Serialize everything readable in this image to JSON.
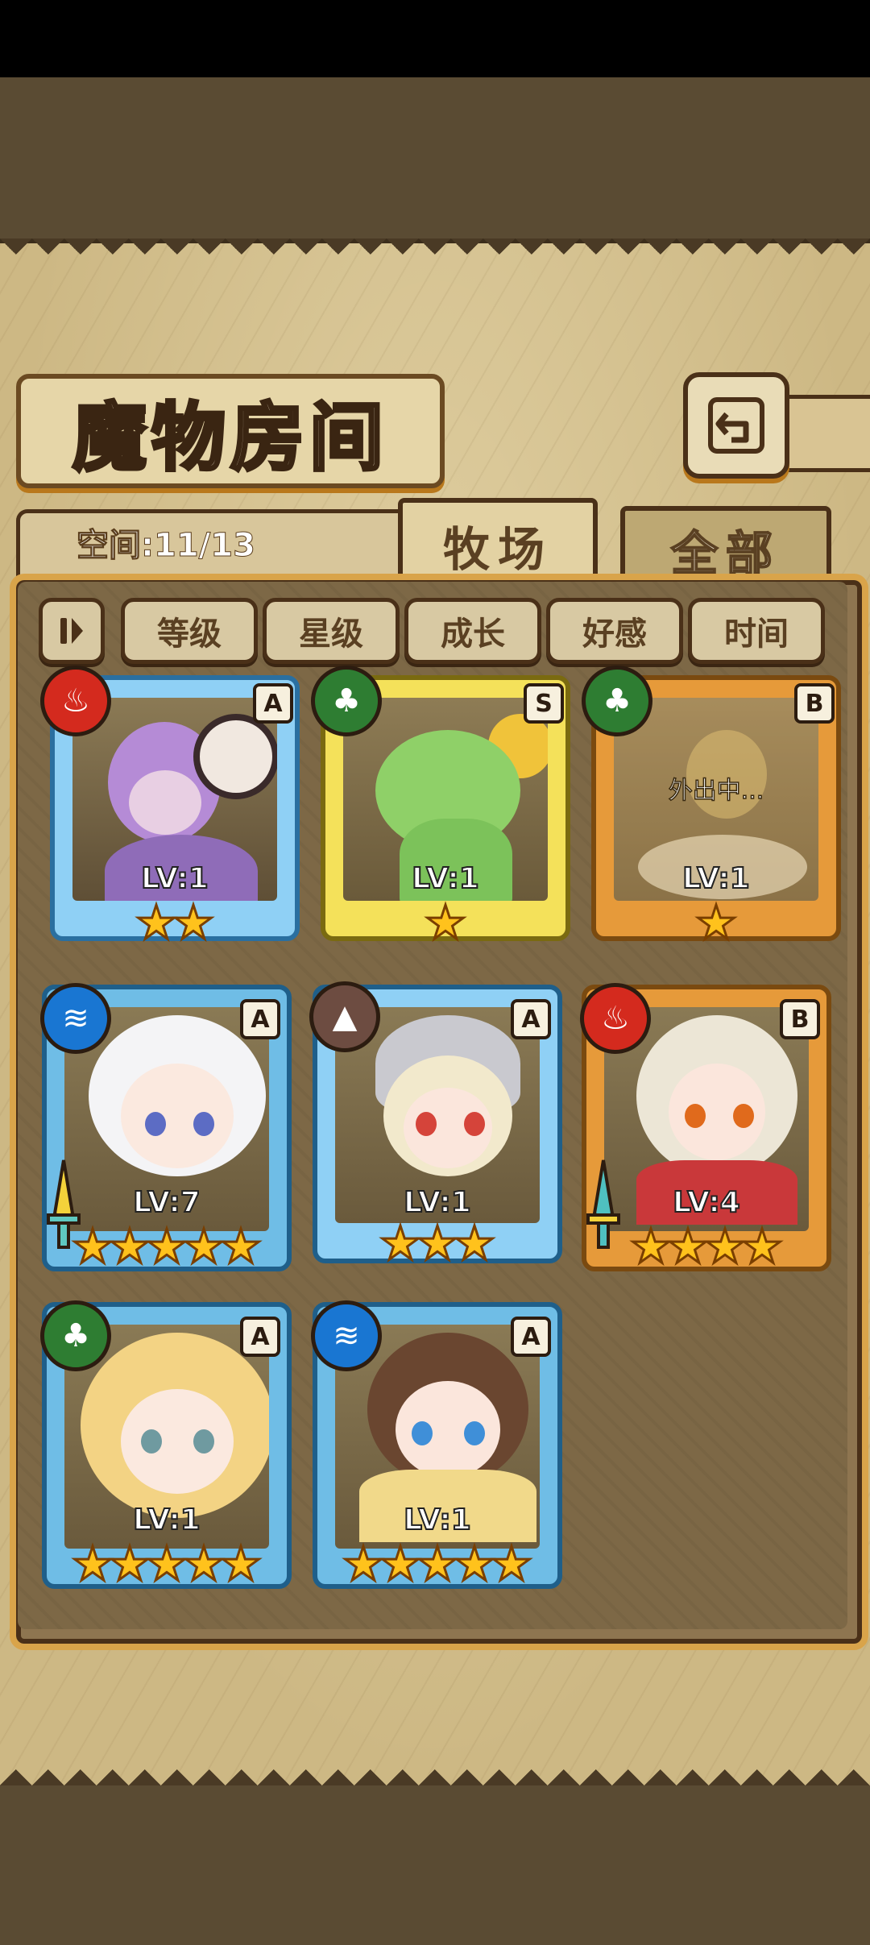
{
  "screen": {
    "title": "魔物房间",
    "back_icon": "return-arrow-icon"
  },
  "capacity": {
    "label": "空间:11/13"
  },
  "tabs": [
    {
      "label": "牧场",
      "active": true
    },
    {
      "label": "全部",
      "active": false
    }
  ],
  "sort": {
    "toggle_icon": "sort-order-icon",
    "buttons": [
      "等级",
      "星级",
      "成长",
      "好感",
      "时间"
    ]
  },
  "colors": {
    "fire": "#d42a1e",
    "grass": "#2e7d32",
    "water": "#1976d2",
    "earth": "#6d4c41",
    "frame_blue": "#5fb3e8",
    "frame_gold": "#f2d24a",
    "frame_orange": "#e69a3a"
  },
  "monsters": [
    {
      "element": "fire",
      "element_icon": "flame-icon",
      "rank": "A",
      "level": "LV:1",
      "stars": 2,
      "status": "",
      "has_weapon": false
    },
    {
      "element": "grass",
      "element_icon": "leaf-icon",
      "rank": "S",
      "level": "LV:1",
      "stars": 1,
      "status": "",
      "has_weapon": false
    },
    {
      "element": "grass",
      "element_icon": "leaf-icon",
      "rank": "B",
      "level": "LV:1",
      "stars": 1,
      "status": "外出中...",
      "has_weapon": false
    },
    {
      "element": "water",
      "element_icon": "waves-icon",
      "rank": "A",
      "level": "LV:7",
      "stars": 5,
      "status": "",
      "has_weapon": true
    },
    {
      "element": "earth",
      "element_icon": "mountain-icon",
      "rank": "A",
      "level": "LV:1",
      "stars": 3,
      "status": "",
      "has_weapon": false
    },
    {
      "element": "fire",
      "element_icon": "flame-icon",
      "rank": "B",
      "level": "LV:4",
      "stars": 4,
      "status": "",
      "has_weapon": true
    },
    {
      "element": "grass",
      "element_icon": "leaf-icon",
      "rank": "A",
      "level": "LV:1",
      "stars": 5,
      "status": "",
      "has_weapon": false
    },
    {
      "element": "water",
      "element_icon": "waves-icon",
      "rank": "A",
      "level": "LV:1",
      "stars": 5,
      "status": "",
      "has_weapon": false
    }
  ]
}
